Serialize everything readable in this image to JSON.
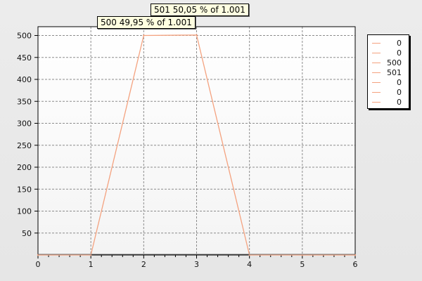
{
  "chart_data": {
    "type": "line",
    "title": "",
    "xlabel": "",
    "ylabel": "",
    "xlim": [
      0,
      6
    ],
    "ylim": [
      0,
      520
    ],
    "x_ticks": [
      "0",
      "1",
      "2",
      "3",
      "4",
      "5",
      "6"
    ],
    "y_ticks": [
      "50",
      "100",
      "150",
      "200",
      "250",
      "300",
      "350",
      "400",
      "450",
      "500"
    ],
    "x_tick_values": [
      0,
      1,
      2,
      3,
      4,
      5,
      6
    ],
    "y_tick_values": [
      50,
      100,
      150,
      200,
      250,
      300,
      350,
      400,
      450,
      500
    ],
    "grid": true,
    "legend_position": "top-right",
    "series": [
      {
        "color": "#f4a27f",
        "points": [
          [
            0,
            0
          ],
          [
            1,
            0
          ],
          [
            2,
            500
          ],
          [
            3,
            501
          ],
          [
            4,
            0
          ],
          [
            5,
            0
          ],
          [
            6,
            0
          ]
        ]
      }
    ],
    "legend_entries": [
      "0",
      "0",
      "500",
      "501",
      "0",
      "0",
      "0"
    ],
    "tooltips": [
      "501 50,05 % of 1.001",
      "500 49,95 % of 1.001"
    ]
  }
}
